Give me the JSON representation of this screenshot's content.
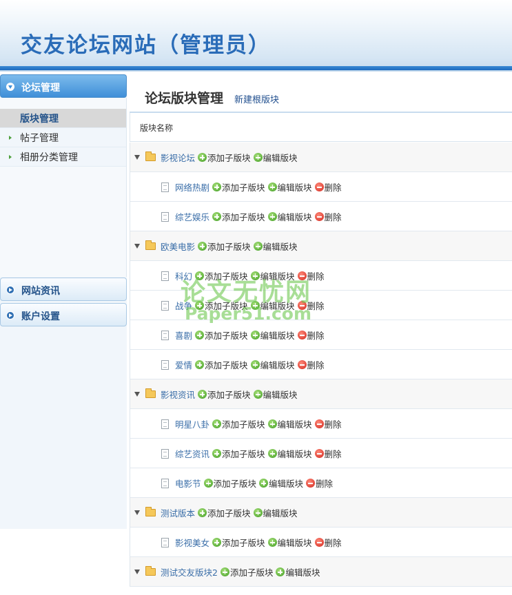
{
  "app": {
    "title": "交友论坛网站（管理员）"
  },
  "sidebar": {
    "sections": [
      {
        "label": "论坛管理"
      },
      {
        "label": "网站资讯"
      },
      {
        "label": "账户设置"
      }
    ],
    "items": [
      {
        "label": "版块管理"
      },
      {
        "label": "帖子管理"
      },
      {
        "label": "相册分类管理"
      }
    ]
  },
  "main": {
    "title": "论坛版块管理",
    "new_root_label": "新建根版块",
    "column_header": "版块名称",
    "actions": {
      "add": "添加子版块",
      "edit": "编辑版块",
      "delete": "删除"
    },
    "rows": [
      {
        "name": "影视论坛",
        "level": 0
      },
      {
        "name": "网络热剧",
        "level": 1
      },
      {
        "name": "综艺娱乐",
        "level": 1
      },
      {
        "name": "欧美电影",
        "level": 0
      },
      {
        "name": "科幻",
        "level": 1
      },
      {
        "name": "战争",
        "level": 1
      },
      {
        "name": "喜剧",
        "level": 1
      },
      {
        "name": "爱情",
        "level": 1
      },
      {
        "name": "影视资讯",
        "level": 0
      },
      {
        "name": "明星八卦",
        "level": 1
      },
      {
        "name": "综艺资讯",
        "level": 1
      },
      {
        "name": "电影节",
        "level": 1
      },
      {
        "name": "测试版本",
        "level": 0
      },
      {
        "name": "影视美女",
        "level": 1
      },
      {
        "name": "测试交友版块2",
        "level": 0
      }
    ]
  },
  "watermark": {
    "line1": "论文无忧网",
    "line2": "Paper51.com"
  },
  "colors": {
    "brand": "#2a6cb8",
    "accent_bar": "#1f6cbf",
    "add_icon": "#3f9c22",
    "delete_icon": "#d2261c"
  },
  "icons": {
    "parent": "folder-icon",
    "child": "document-icon",
    "add": "plus-circle-icon",
    "delete": "minus-circle-icon",
    "expand": "triangle-down-icon"
  }
}
